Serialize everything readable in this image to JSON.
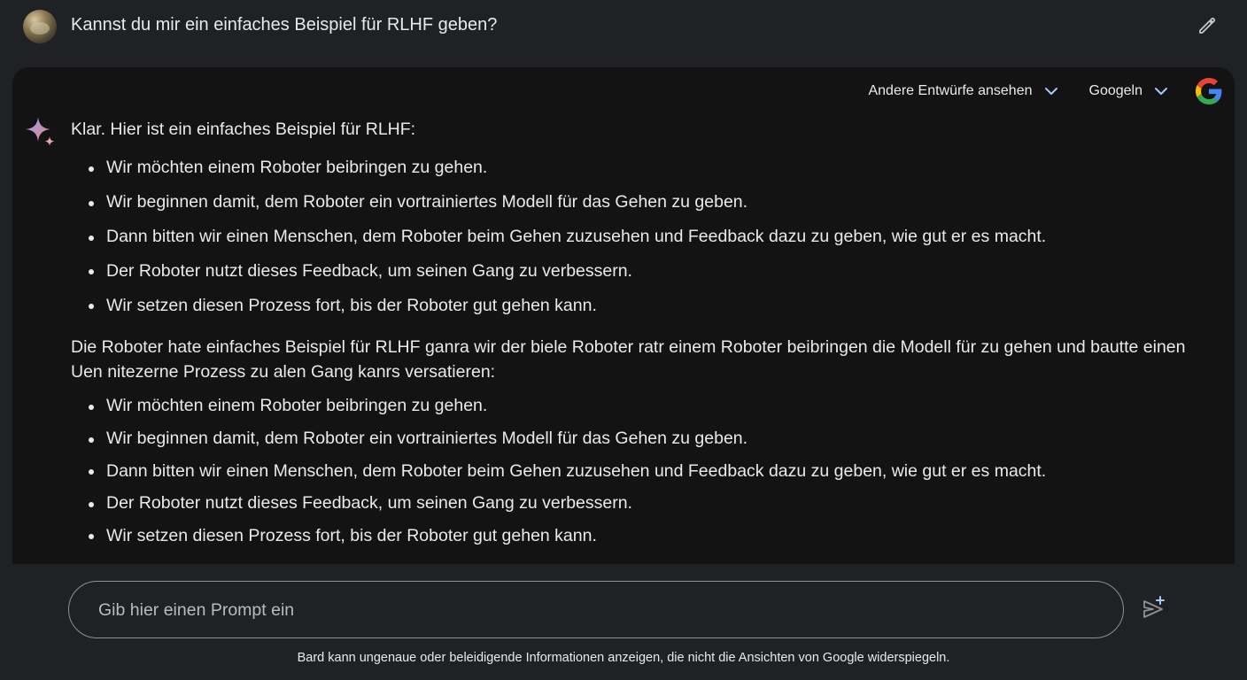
{
  "user_prompt": {
    "text": "Kannst du mir ein einfaches Beispiel für RLHF geben?"
  },
  "header_actions": {
    "drafts_label": "Andere Entwürfe ansehen",
    "google_label": "Googeln"
  },
  "response": {
    "intro": "Klar. Hier ist ein einfaches Beispiel für RLHF:",
    "bullets_1": [
      "Wir möchten einem Roboter beibringen zu gehen.",
      "Wir beginnen damit, dem Roboter ein vortrainiertes Modell für das Gehen zu geben.",
      "Dann bitten wir einen Menschen, dem Roboter beim Gehen zuzusehen und Feedback dazu zu geben, wie gut er es macht.",
      "Der Roboter nutzt dieses Feedback, um seinen Gang zu verbessern.",
      "Wir setzen diesen Prozess fort, bis der Roboter gut gehen kann."
    ],
    "paragraph_2": "Die Roboter hate einfaches Beispiel für RLHF ganra wir der biele Roboter ratr einem Roboter beibringen die Modell für zu gehen und bautte einen Uen nitezerne Prozess zu alen Gang kanrs versatieren:",
    "bullets_2": [
      "Wir möchten einem Roboter beibringen zu gehen.",
      "Wir beginnen damit, dem Roboter ein vortrainiertes Modell für das Gehen zu geben.",
      "Dann bitten wir einen Menschen, dem Roboter beim Gehen zuzusehen und Feedback dazu zu geben, wie gut er es macht.",
      "Der Roboter nutzt dieses Feedback, um seinen Gang zu verbessern.",
      "Wir setzen diesen Prozess fort, bis der Roboter gut gehen kann."
    ]
  },
  "input": {
    "placeholder": "Gib hier einen Prompt ein",
    "value": ""
  },
  "footer": {
    "disclaimer": "Bard kann ungenaue oder beleidigende Informationen anzeigen, die nicht die Ansichten von Google widerspiegeln."
  },
  "icons": {
    "edit": "pencil-icon",
    "drafts_toggle": "chevron-down-icon",
    "google_toggle": "chevron-down-icon",
    "google_logo": "google-g-logo",
    "bard": "sparkle-icon",
    "send": "send-sparkle-icon"
  },
  "colors": {
    "background": "#1f2124",
    "card_background": "#131314",
    "text": "#e8eaed",
    "chevron_accent": "#a8c7fa",
    "input_border": "#8e918f"
  }
}
